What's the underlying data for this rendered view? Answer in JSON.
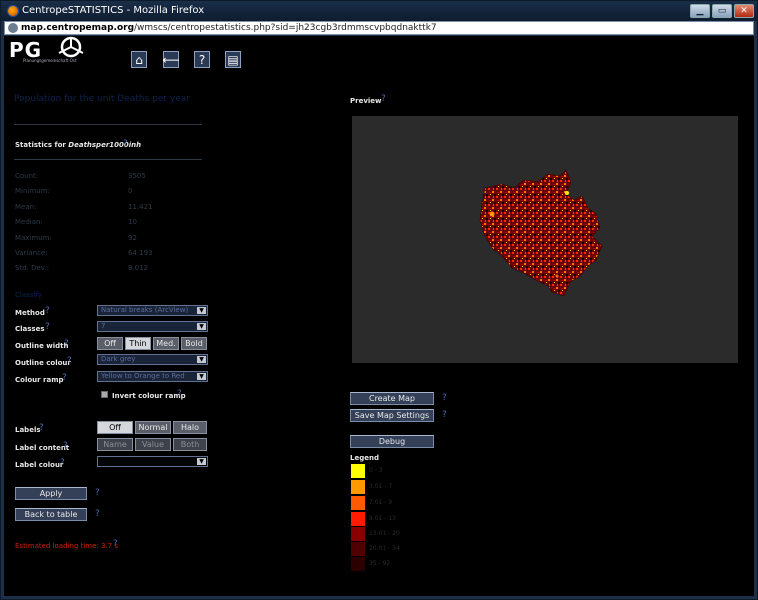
{
  "window": {
    "title": "CentropeSTATISTICS - Mozilla Firefox",
    "min_label": "▁",
    "max_label": "▭",
    "close_label": "✕"
  },
  "urlbar": {
    "domain": "map.centropemap.org",
    "path": "/wmscs/centropestatistics.php?sid=jh23cgb3rdmmscvpbqdnakttk7"
  },
  "logo": {
    "text": "PG",
    "subtitle": "Planungsgemeinschaft Ost"
  },
  "nav_icons": [
    "home-icon",
    "back-arrow-icon",
    "help-icon",
    "table-icon"
  ],
  "page_heading": "Population for the unit Deaths per year",
  "stats": {
    "title_prefix": "Statistics for",
    "variable": "Deathsper1000inh",
    "rows": [
      {
        "label": "Count:",
        "value": "3505"
      },
      {
        "label": "Minimum:",
        "value": "0"
      },
      {
        "label": "Mean:",
        "value": "11.421"
      },
      {
        "label": "Median:",
        "value": "10"
      },
      {
        "label": "Maximum:",
        "value": "92"
      },
      {
        "label": "Variance:",
        "value": "64.193"
      },
      {
        "label": "Std. Dev.:",
        "value": "8.012"
      }
    ]
  },
  "classify_heading": "Classify",
  "controls": {
    "method_label": "Method",
    "method_value": "Natural breaks (ArcView)",
    "classes_label": "Classes",
    "classes_value": "7",
    "outline_width_label": "Outline width",
    "outline_width_options": [
      "Off",
      "Thin",
      "Med.",
      "Bold"
    ],
    "outline_width_selected": "Thin",
    "outline_colour_label": "Outline colour",
    "outline_colour_value": "Dark grey",
    "colour_ramp_label": "Colour ramp",
    "colour_ramp_value": "Yellow to Orange to Red",
    "invert_label": "Invert colour ramp",
    "labels_label": "Labels",
    "labels_options": [
      "Off",
      "Normal",
      "Halo"
    ],
    "labels_selected": "Off",
    "label_content_label": "Label content",
    "label_content_options": [
      "Name",
      "Value",
      "Both"
    ],
    "label_colour_label": "Label colour",
    "label_colour_value": ""
  },
  "buttons": {
    "apply": "Apply",
    "back_to_table": "Back to table",
    "create_map": "Create Map",
    "save_map_settings": "Save Map Settings",
    "debug": "Debug"
  },
  "estimate": "Estimated loading time: 3.7 s",
  "preview_label": "Preview",
  "help_mark": "?",
  "legend": {
    "title": "Legend",
    "items": [
      {
        "label": "0 - 3",
        "color": "#ffff00"
      },
      {
        "label": "3.01 - 7",
        "color": "#ff9900"
      },
      {
        "label": "7.01 - 9",
        "color": "#ff5a00"
      },
      {
        "label": "9.01 - 13",
        "color": "#ff1a00"
      },
      {
        "label": "13.01 - 20",
        "color": "#8a0000"
      },
      {
        "label": "20.01 - 34",
        "color": "#500000"
      },
      {
        "label": "35 - 92",
        "color": "#2a0000"
      }
    ]
  }
}
